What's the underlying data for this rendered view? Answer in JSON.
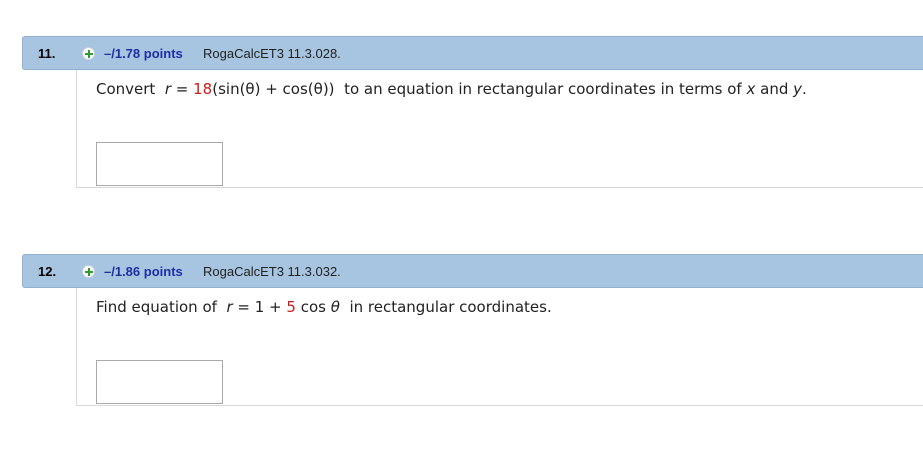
{
  "questions": [
    {
      "number": "11.",
      "points": "–/1.78 points",
      "source": "RogaCalcET3 11.3.028.",
      "prompt": {
        "p1": "Convert",
        "var_r": "r",
        "eq": " = ",
        "coef": "18",
        "expr": "(sin(θ) + cos(θ))",
        "p2": " to an equation in rectangular coordinates in terms of ",
        "var_x": "x",
        "and": " and ",
        "var_y": "y",
        "end": "."
      },
      "answer_value": ""
    },
    {
      "number": "12.",
      "points": "–/1.86 points",
      "source": "RogaCalcET3 11.3.032.",
      "prompt": {
        "p1": "Find equation of",
        "var_r": "r",
        "eq": " = 1 + ",
        "coef": "5",
        "expr": " cos ",
        "theta": "θ",
        "p2": " in rectangular coordinates."
      },
      "answer_value": ""
    }
  ]
}
